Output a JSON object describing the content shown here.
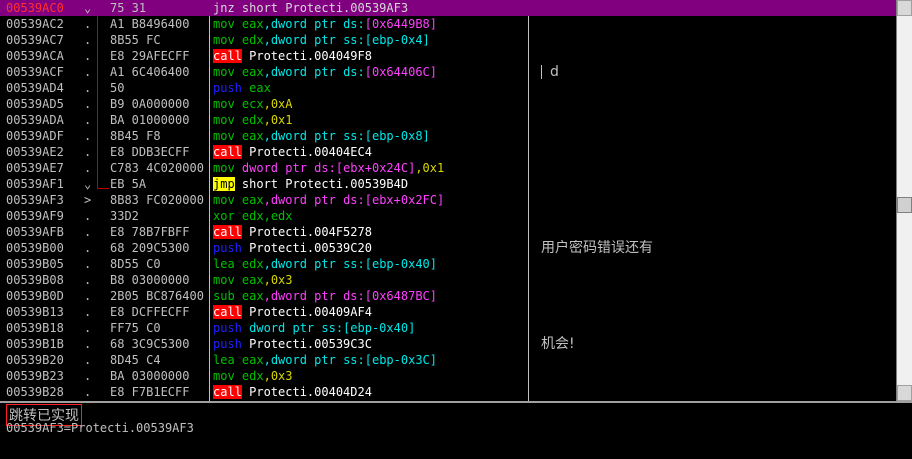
{
  "rows": [
    {
      "addr": "00539AC0",
      "mark": "⌄",
      "hex": "75 31",
      "selected": true,
      "dis": [
        {
          "t": "jnz short Protecti.00539AF3",
          "c": "m-jnz"
        }
      ]
    },
    {
      "addr": "00539AC2",
      "mark": ".",
      "hex": "A1 B8496400",
      "dis": [
        {
          "t": "mov",
          "c": "m-mov"
        },
        {
          "t": " eax",
          "c": "reg"
        },
        {
          "t": ",dword ptr ds:",
          "c": "mem"
        },
        {
          "t": "[0x6449B8]",
          "c": "dword"
        }
      ]
    },
    {
      "addr": "00539AC7",
      "mark": ".",
      "hex": "8B55 FC",
      "dis": [
        {
          "t": "mov",
          "c": "m-mov"
        },
        {
          "t": " edx",
          "c": "reg"
        },
        {
          "t": ",dword ptr ss:",
          "c": "mem"
        },
        {
          "t": "[ebp-0x4]",
          "c": "mem"
        }
      ]
    },
    {
      "addr": "00539ACA",
      "mark": ".",
      "hex": "E8 29AFECFF",
      "dis": [
        {
          "t": "call",
          "c": "m-call"
        },
        {
          "t": " Protecti.004049F8",
          "c": "sym"
        }
      ]
    },
    {
      "addr": "00539ACF",
      "mark": ".",
      "hex": "A1 6C406400",
      "dis": [
        {
          "t": "mov",
          "c": "m-mov"
        },
        {
          "t": " eax",
          "c": "reg"
        },
        {
          "t": ",dword ptr ds:",
          "c": "mem"
        },
        {
          "t": "[0x64406C]",
          "c": "dword"
        }
      ]
    },
    {
      "addr": "00539AD4",
      "mark": ".",
      "hex": "50",
      "dis": [
        {
          "t": "push",
          "c": "m-push"
        },
        {
          "t": " eax",
          "c": "reg"
        }
      ]
    },
    {
      "addr": "00539AD5",
      "mark": ".",
      "hex": "B9 0A000000",
      "dis": [
        {
          "t": "mov",
          "c": "m-mov"
        },
        {
          "t": " ecx",
          "c": "reg"
        },
        {
          "t": ",0xA",
          "c": "num"
        }
      ]
    },
    {
      "addr": "00539ADA",
      "mark": ".",
      "hex": "BA 01000000",
      "dis": [
        {
          "t": "mov",
          "c": "m-mov"
        },
        {
          "t": " edx",
          "c": "reg"
        },
        {
          "t": ",0x1",
          "c": "num"
        }
      ]
    },
    {
      "addr": "00539ADF",
      "mark": ".",
      "hex": "8B45 F8",
      "dis": [
        {
          "t": "mov",
          "c": "m-mov"
        },
        {
          "t": " eax",
          "c": "reg"
        },
        {
          "t": ",dword ptr ss:",
          "c": "mem"
        },
        {
          "t": "[ebp-0x8]",
          "c": "mem"
        }
      ]
    },
    {
      "addr": "00539AE2",
      "mark": ".",
      "hex": "E8 DDB3ECFF",
      "dis": [
        {
          "t": "call",
          "c": "m-call"
        },
        {
          "t": " Protecti.00404EC4",
          "c": "sym"
        }
      ]
    },
    {
      "addr": "00539AE7",
      "mark": ".",
      "hex": "C783 4C020000",
      "dis": [
        {
          "t": "mov",
          "c": "m-mov"
        },
        {
          "t": " dword ptr ds:",
          "c": "dword"
        },
        {
          "t": "[ebx+0x24C]",
          "c": "dword"
        },
        {
          "t": ",0x1",
          "c": "num"
        }
      ]
    },
    {
      "addr": "00539AF1",
      "mark": "⌄",
      "hex": "EB 5A",
      "dis": [
        {
          "t": "jmp",
          "c": "m-jmp"
        },
        {
          "t": " short Protecti.00539B4D",
          "c": "sym"
        }
      ]
    },
    {
      "addr": "00539AF3",
      "mark": ">",
      "hex": "8B83 FC020000",
      "dis": [
        {
          "t": "mov",
          "c": "m-mov"
        },
        {
          "t": " eax",
          "c": "reg"
        },
        {
          "t": ",dword ptr ds:",
          "c": "dword"
        },
        {
          "t": "[ebx+0x2FC]",
          "c": "dword"
        }
      ]
    },
    {
      "addr": "00539AF9",
      "mark": ".",
      "hex": "33D2",
      "dis": [
        {
          "t": "xor",
          "c": "m-mov"
        },
        {
          "t": " edx",
          "c": "reg"
        },
        {
          "t": ",edx",
          "c": "reg"
        }
      ]
    },
    {
      "addr": "00539AFB",
      "mark": ".",
      "hex": "E8 78B7FBFF",
      "dis": [
        {
          "t": "call",
          "c": "m-call"
        },
        {
          "t": " Protecti.004F5278",
          "c": "sym"
        }
      ]
    },
    {
      "addr": "00539B00",
      "mark": ".",
      "hex": "68 209C5300",
      "dis": [
        {
          "t": "push",
          "c": "m-push"
        },
        {
          "t": " Protecti.00539C20",
          "c": "sym"
        }
      ]
    },
    {
      "addr": "00539B05",
      "mark": ".",
      "hex": "8D55 C0",
      "dis": [
        {
          "t": "lea",
          "c": "m-mov"
        },
        {
          "t": " edx",
          "c": "reg"
        },
        {
          "t": ",dword ptr ss:",
          "c": "mem"
        },
        {
          "t": "[ebp-0x40]",
          "c": "mem"
        }
      ]
    },
    {
      "addr": "00539B08",
      "mark": ".",
      "hex": "B8 03000000",
      "dis": [
        {
          "t": "mov",
          "c": "m-mov"
        },
        {
          "t": " eax",
          "c": "reg"
        },
        {
          "t": ",0x3",
          "c": "num"
        }
      ]
    },
    {
      "addr": "00539B0D",
      "mark": ".",
      "hex": "2B05 BC876400",
      "dis": [
        {
          "t": "sub",
          "c": "m-mov"
        },
        {
          "t": " eax",
          "c": "reg"
        },
        {
          "t": ",dword ptr ds:",
          "c": "dword"
        },
        {
          "t": "[0x6487BC]",
          "c": "dword"
        }
      ]
    },
    {
      "addr": "00539B13",
      "mark": ".",
      "hex": "E8 DCFFECFF",
      "dis": [
        {
          "t": "call",
          "c": "m-call"
        },
        {
          "t": " Protecti.00409AF4",
          "c": "sym"
        }
      ]
    },
    {
      "addr": "00539B18",
      "mark": ".",
      "hex": "FF75 C0",
      "dis": [
        {
          "t": "push",
          "c": "m-push"
        },
        {
          "t": " dword ptr ss:",
          "c": "mem"
        },
        {
          "t": "[ebp-0x40]",
          "c": "mem"
        }
      ]
    },
    {
      "addr": "00539B1B",
      "mark": ".",
      "hex": "68 3C9C5300",
      "dis": [
        {
          "t": "push",
          "c": "m-push"
        },
        {
          "t": " Protecti.00539C3C",
          "c": "sym"
        }
      ]
    },
    {
      "addr": "00539B20",
      "mark": ".",
      "hex": "8D45 C4",
      "dis": [
        {
          "t": "lea",
          "c": "m-mov"
        },
        {
          "t": " eax",
          "c": "reg"
        },
        {
          "t": ",dword ptr ss:",
          "c": "mem"
        },
        {
          "t": "[ebp-0x3C]",
          "c": "mem"
        }
      ]
    },
    {
      "addr": "00539B23",
      "mark": ".",
      "hex": "BA 03000000",
      "dis": [
        {
          "t": "mov",
          "c": "m-mov"
        },
        {
          "t": " edx",
          "c": "reg"
        },
        {
          "t": ",0x3",
          "c": "num"
        }
      ]
    },
    {
      "addr": "00539B28",
      "mark": ".",
      "hex": "E8 F7B1ECFF",
      "dis": [
        {
          "t": "call",
          "c": "m-call"
        },
        {
          "t": " Protecti.00404D24",
          "c": "sym"
        }
      ]
    }
  ],
  "comments": {
    "4": "d",
    "15": "用户密码错误还有",
    "21": "机会!"
  },
  "info": {
    "line1": "跳转已实现",
    "line2": "00539AF3=Protecti.00539AF3"
  }
}
